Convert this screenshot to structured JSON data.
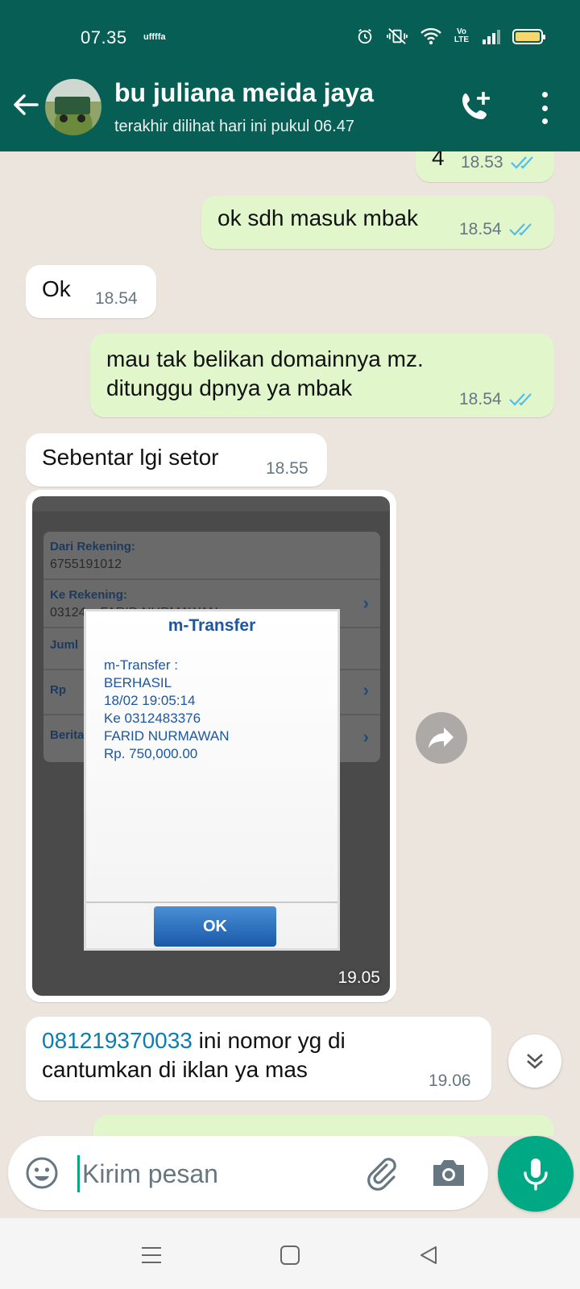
{
  "status_bar": {
    "time": "07.35",
    "extra": "uffffa",
    "network": "Vo LTE"
  },
  "header": {
    "contact_name": "bu juliana meida jaya",
    "last_seen": "terakhir dilihat hari ini pukul 06.47",
    "icons": [
      "back-arrow-icon",
      "avatar",
      "add-call-icon",
      "more-vert-icon"
    ],
    "color": "#075e54"
  },
  "messages": [
    {
      "direction": "out",
      "text": "4",
      "time": "18.53",
      "status": "read"
    },
    {
      "direction": "out",
      "text": "ok sdh masuk mbak",
      "time": "18.54",
      "status": "read"
    },
    {
      "direction": "in",
      "text": "Ok",
      "time": "18.54"
    },
    {
      "direction": "out",
      "text_line1": "mau tak belikan domainnya mz.",
      "text_line2": "ditunggu dpnya ya mbak",
      "time": "18.54",
      "status": "read"
    },
    {
      "direction": "in",
      "text": "Sebentar lgi setor",
      "time": "18.55"
    },
    {
      "direction": "in",
      "type": "image",
      "time": "19.05",
      "image": {
        "form": {
          "dari_label": "Dari Rekening:",
          "dari_value": "6755191012",
          "ke_label": "Ke Rekening:",
          "ke_value": "03124...  FARID NURMAWAN",
          "jumlah_label": "Juml",
          "rp_label": "Rp",
          "berita_label": "Berita"
        },
        "dialog": {
          "title": "m-Transfer",
          "lines": [
            "m-Transfer :",
            "BERHASIL",
            "18/02 19:05:14",
            "Ke 0312483376",
            "FARID NURMAWAN",
            "Rp. 750,000.00"
          ],
          "ok_label": "OK"
        }
      }
    },
    {
      "direction": "in",
      "link": "081219370033",
      "text_after_link": " ini nomor yg di",
      "text_line2": "cantumkan di iklan ya mas",
      "time": "19.06"
    }
  ],
  "input": {
    "placeholder": "Kirim pesan",
    "value": ""
  },
  "colors": {
    "accent": "#00a884",
    "outgoing_bubble": "#e1f7cb",
    "incoming_bubble": "#ffffff",
    "read_ticks": "#53bdeb",
    "chat_background": "#ece5dd"
  }
}
